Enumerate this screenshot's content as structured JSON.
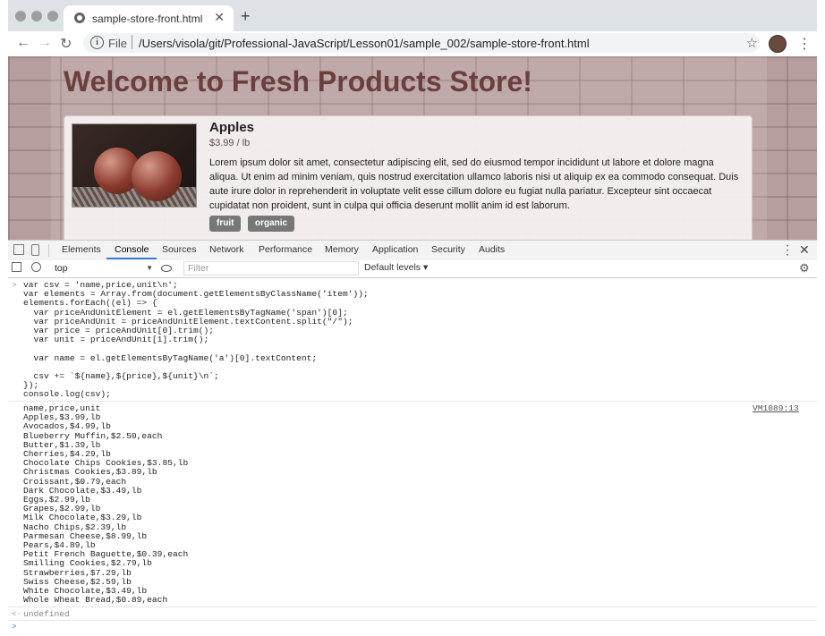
{
  "browser": {
    "tab_title": "sample-store-front.html",
    "tab_close": "✕",
    "new_tab": "+",
    "file_label": "File",
    "url": "/Users/visola/git/Professional-JavaScript/Lesson01/sample_002/sample-store-front.html",
    "back": "←",
    "forward": "→",
    "reload": "↻",
    "info": "i",
    "star": "☆",
    "menu": "⋮"
  },
  "page": {
    "heading": "Welcome to Fresh Products Store!",
    "product": {
      "name": "Apples",
      "price": "$3.99 / lb",
      "description": "Lorem ipsum dolor sit amet, consectetur adipiscing elit, sed do eiusmod tempor incididunt ut labore et dolore magna aliqua. Ut enim ad minim veniam, quis nostrud exercitation ullamco laboris nisi ut aliquip ex ea commodo consequat. Duis aute irure dolor in reprehenderit in voluptate velit esse cillum dolore eu fugiat nulla pariatur. Excepteur sint occaecat cupidatat non proident, sunt in culpa qui officia deserunt mollit anim id est laborum.",
      "tags": [
        "fruit",
        "organic"
      ]
    }
  },
  "devtools": {
    "tabs": [
      "Elements",
      "Console",
      "Sources",
      "Network",
      "Performance",
      "Memory",
      "Application",
      "Security",
      "Audits"
    ],
    "active_tab": "Console",
    "more": "⋮",
    "close": "✕",
    "context": "top",
    "filter_placeholder": "Filter",
    "levels": "Default levels ▾",
    "gear": "⚙",
    "input_code": "var csv = 'name,price,unit\\n';\nvar elements = Array.from(document.getElementsByClassName('item'));\nelements.forEach((el) => {\n  var priceAndUnitElement = el.getElementsByTagName('span')[0];\n  var priceAndUnit = priceAndUnitElement.textContent.split(\"/\");\n  var price = priceAndUnit[0].trim();\n  var unit = priceAndUnit[1].trim();\n\n  var name = el.getElementsByTagName('a')[0].textContent;\n\n  csv += `${name},${price},${unit}\\n`;\n});\nconsole.log(csv);",
    "output": "name,price,unit\nApples,$3.99,lb\nAvocados,$4.99,lb\nBlueberry Muffin,$2.50,each\nButter,$1.39,lb\nCherries,$4.29,lb\nChocolate Chips Cookies,$3.85,lb\nChristmas Cookies,$3.89,lb\nCroissant,$0.79,each\nDark Chocolate,$3.49,lb\nEggs,$2.99,lb\nGrapes,$2.99,lb\nMilk Chocolate,$3.29,lb\nNacho Chips,$2.39,lb\nParmesan Cheese,$8.99,lb\nPears,$4.89,lb\nPetit French Baguette,$0.39,each\nSmilling Cookies,$2.79,lb\nStrawberries,$7.29,lb\nSwiss Cheese,$2.59,lb\nWhite Chocolate,$3.49,lb\nWhole Wheat Bread,$0.89,each",
    "source_link": "VM1089:13",
    "return_value": "undefined",
    "prompt_in": ">",
    "prompt_ret": "<·"
  }
}
